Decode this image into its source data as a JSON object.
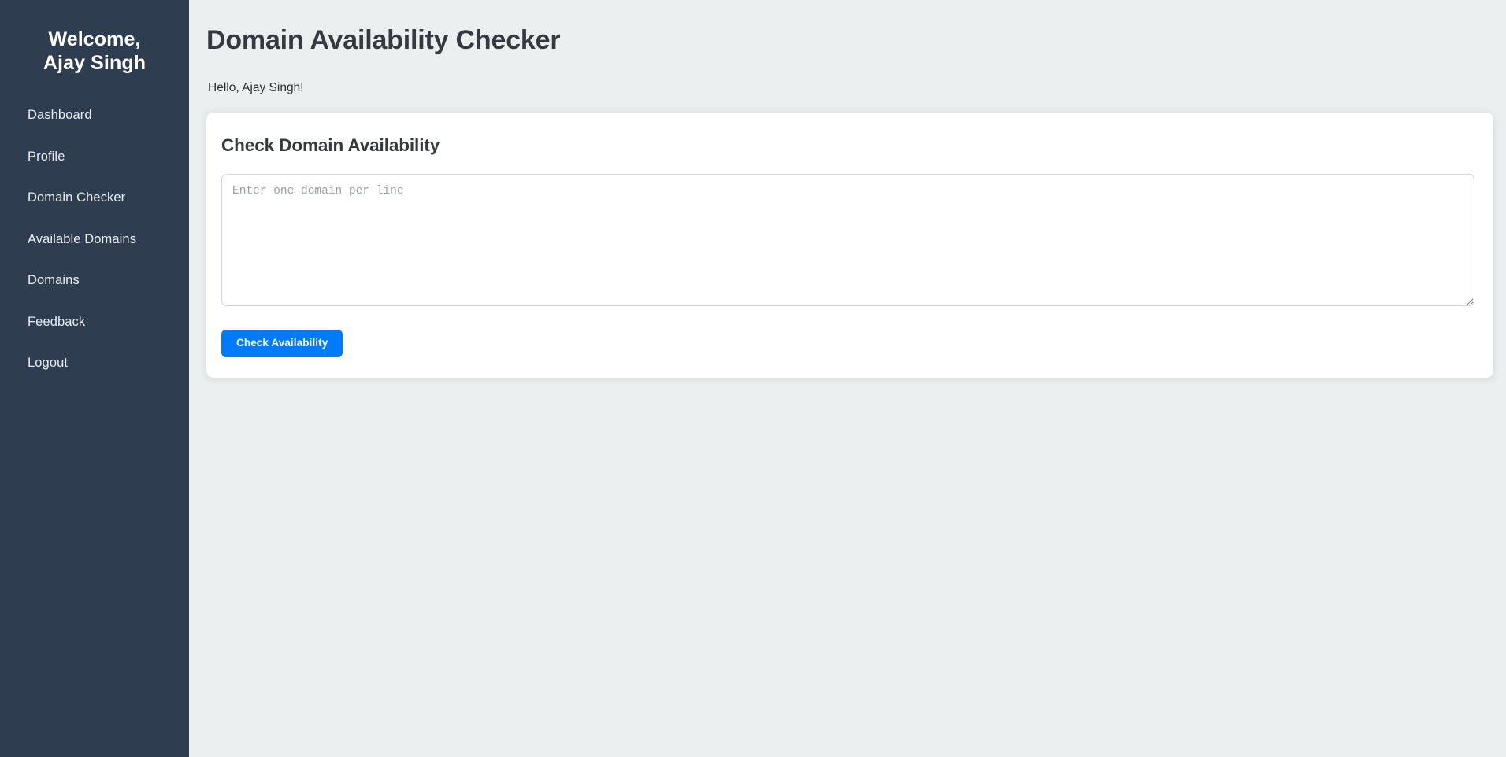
{
  "sidebar": {
    "welcome_line1": "Welcome,",
    "welcome_line2": "Ajay Singh",
    "items": [
      {
        "label": "Dashboard"
      },
      {
        "label": "Profile"
      },
      {
        "label": "Domain Checker"
      },
      {
        "label": "Available Domains"
      },
      {
        "label": "Domains"
      },
      {
        "label": "Feedback"
      },
      {
        "label": "Logout"
      }
    ],
    "background_color": "#2e3e50",
    "text_color": "#e9edf1"
  },
  "main": {
    "page_title": "Domain Availability Checker",
    "greeting": "Hello, Ajay Singh!",
    "background_color": "#eceff0"
  },
  "card": {
    "title": "Check Domain Availability",
    "textarea_value": "",
    "textarea_placeholder": "Enter one domain per line",
    "submit_label": "Check Availability",
    "submit_color": "#007bff",
    "background_color": "#ffffff"
  }
}
